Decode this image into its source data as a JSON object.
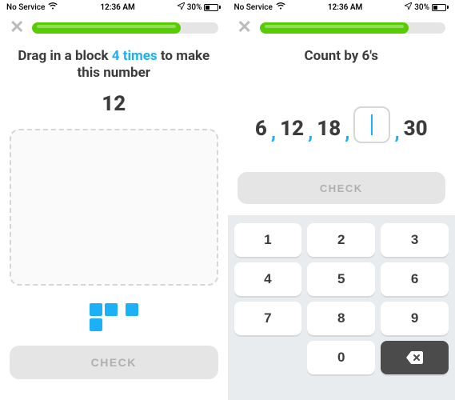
{
  "status": {
    "carrier": "No Service",
    "time": "12:36 AM",
    "battery_pct": "30%"
  },
  "left": {
    "progress_pct": 80,
    "prompt_pre": "Drag in a block ",
    "prompt_accent": "4 times",
    "prompt_post": " to make this number",
    "target": "12",
    "check_label": "CHECK"
  },
  "right": {
    "progress_pct": 80,
    "prompt": "Count by 6's",
    "sequence": [
      "6",
      "12",
      "18",
      "",
      "30"
    ],
    "check_label": "CHECK",
    "keypad": [
      "1",
      "2",
      "3",
      "4",
      "5",
      "6",
      "7",
      "8",
      "9",
      "0"
    ]
  }
}
